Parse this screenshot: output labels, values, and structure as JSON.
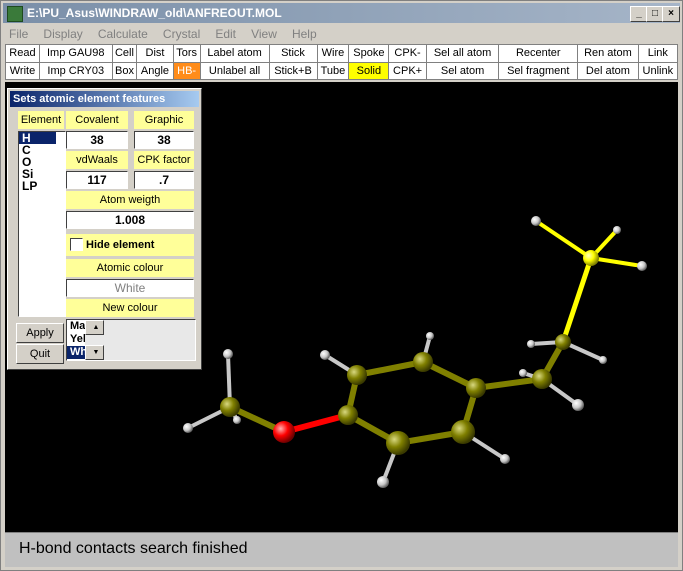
{
  "window": {
    "title": "E:\\PU_Asus\\WINDRAW_old\\ANFREOUT.MOL",
    "minimize": "_",
    "maximize": "□",
    "close": "×"
  },
  "menu": [
    "File",
    "Display",
    "Calculate",
    "Crystal",
    "Edit",
    "View",
    "Help"
  ],
  "toolbar": {
    "row1": [
      "Read",
      "Imp GAU98",
      "Cell",
      "Dist",
      "Tors",
      "Label atom",
      "Stick",
      "Wire",
      "Spoke",
      "CPK-",
      "Sel all atom",
      "Recenter",
      "Ren atom",
      "Link"
    ],
    "row2": [
      "Write",
      "Imp CRY03",
      "Box",
      "Angle",
      "HB-",
      "Unlabel all",
      "Stick+B",
      "Tube",
      "Solid",
      "CPK+",
      "Sel atom",
      "Sel fragment",
      "Del atom",
      "Unlink"
    ]
  },
  "panel": {
    "title": "Sets atomic element features",
    "element_label": "Element",
    "elements": [
      "H",
      "C",
      "O",
      "Si",
      "LP"
    ],
    "selected_element": "H",
    "covalent_label": "Covalent",
    "covalent_value": "38",
    "graphic_label": "Graphic",
    "graphic_value": "38",
    "vdwaals_label": "vdWaals",
    "vdwaals_value": "117",
    "cpk_label": "CPK factor",
    "cpk_value": ".7",
    "atom_weight_label": "Atom weigth",
    "atom_weight_value": "1.008",
    "hide_element_label": "Hide element",
    "hide_element_checked": false,
    "atomic_colour_label": "Atomic colour",
    "atomic_colour_value": "White",
    "new_colour_label": "New  colour",
    "colour_options": [
      "Magenta",
      "Yellow",
      "White"
    ],
    "selected_colour": "White",
    "apply_label": "Apply",
    "quit_label": "Quit"
  },
  "status": {
    "message": "H-bond contacts search finished"
  },
  "colors": {
    "canvas_bg": "#000000",
    "carbon": "#808000",
    "oxygen": "#ff0000",
    "hydrogen": "#ffffff",
    "silicon": "#ffff00",
    "hb_button": "#ff8c1a",
    "solid_button": "#ffff00",
    "label_bg": "#ffff99"
  }
}
